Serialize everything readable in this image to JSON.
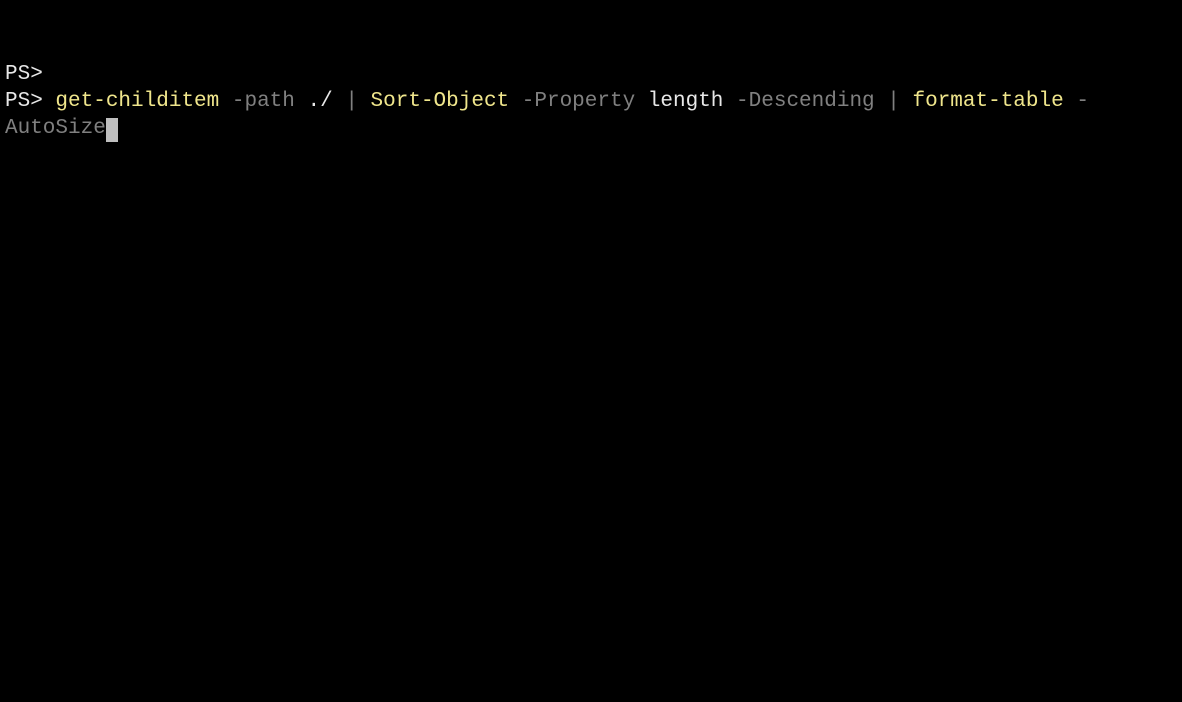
{
  "terminal": {
    "lines": [
      {
        "prompt": "PS>",
        "content": ""
      },
      {
        "prompt": "PS>",
        "tokens": {
          "cmd1": "get-childitem",
          "param1": "-path",
          "arg1": "./",
          "pipe1": "|",
          "cmd2": "Sort-Object",
          "param2": "-Property",
          "arg2": "length",
          "param3": "-Descending",
          "pipe2": "|",
          "cmd3": "format-table",
          "param4": "-AutoSize"
        }
      }
    ]
  }
}
